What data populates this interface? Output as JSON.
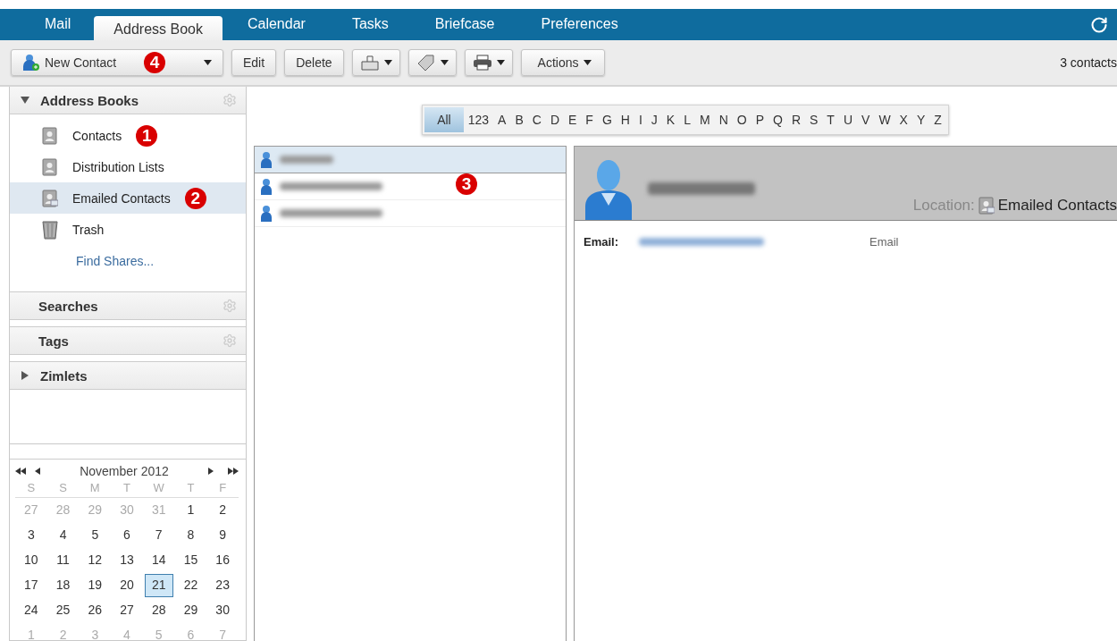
{
  "nav": {
    "tabs": [
      {
        "label": "Mail",
        "selected": false
      },
      {
        "label": "Address Book",
        "selected": true
      },
      {
        "label": "Calendar",
        "selected": false
      },
      {
        "label": "Tasks",
        "selected": false
      },
      {
        "label": "Briefcase",
        "selected": false
      },
      {
        "label": "Preferences",
        "selected": false
      }
    ]
  },
  "toolbar": {
    "new_button": {
      "label": "New Contact",
      "badge": "4"
    },
    "buttons": [
      {
        "kind": "text",
        "label": "Edit"
      },
      {
        "kind": "text",
        "label": "Delete"
      },
      {
        "kind": "move"
      },
      {
        "kind": "tag"
      },
      {
        "kind": "print"
      },
      {
        "kind": "menu",
        "label": "Actions"
      }
    ],
    "count": "3 contacts"
  },
  "sidebar": {
    "sections": [
      {
        "title": "Address Books",
        "expanded": true,
        "items": [
          {
            "kind": "book",
            "label": "Contacts",
            "selected": false,
            "badge": "1"
          },
          {
            "kind": "book",
            "label": "Distribution Lists",
            "selected": false
          },
          {
            "kind": "emailed",
            "label": "Emailed Contacts",
            "selected": true,
            "badge": "2"
          },
          {
            "kind": "trash",
            "label": "Trash",
            "selected": false
          },
          {
            "kind": "link",
            "label": "Find Shares..."
          }
        ]
      },
      {
        "title": "Searches"
      },
      {
        "title": "Tags"
      },
      {
        "title": "Zimlets",
        "expanded": false
      }
    ]
  },
  "calendar": {
    "title": "November 2012",
    "weekdays": [
      "S",
      "S",
      "M",
      "T",
      "W",
      "T",
      "F"
    ],
    "weeks": [
      [
        {
          "d": "27",
          "muted": true,
          "selected": false
        },
        {
          "d": "28",
          "muted": true,
          "selected": false
        },
        {
          "d": "29",
          "muted": true,
          "selected": false
        },
        {
          "d": "30",
          "muted": true,
          "selected": false
        },
        {
          "d": "31",
          "muted": true,
          "selected": false
        },
        {
          "d": "1",
          "muted": false,
          "selected": false
        },
        {
          "d": "2",
          "muted": false,
          "selected": false
        }
      ],
      [
        {
          "d": "3",
          "muted": false,
          "selected": false
        },
        {
          "d": "4",
          "muted": false,
          "selected": false
        },
        {
          "d": "5",
          "muted": false,
          "selected": false
        },
        {
          "d": "6",
          "muted": false,
          "selected": false
        },
        {
          "d": "7",
          "muted": false,
          "selected": false
        },
        {
          "d": "8",
          "muted": false,
          "selected": false
        },
        {
          "d": "9",
          "muted": false,
          "selected": false
        }
      ],
      [
        {
          "d": "10",
          "muted": false,
          "selected": false
        },
        {
          "d": "11",
          "muted": false,
          "selected": false
        },
        {
          "d": "12",
          "muted": false,
          "selected": false
        },
        {
          "d": "13",
          "muted": false,
          "selected": false
        },
        {
          "d": "14",
          "muted": false,
          "selected": false
        },
        {
          "d": "15",
          "muted": false,
          "selected": false
        },
        {
          "d": "16",
          "muted": false,
          "selected": false
        }
      ],
      [
        {
          "d": "17",
          "muted": false,
          "selected": false
        },
        {
          "d": "18",
          "muted": false,
          "selected": false
        },
        {
          "d": "19",
          "muted": false,
          "selected": false
        },
        {
          "d": "20",
          "muted": false,
          "selected": false
        },
        {
          "d": "21",
          "muted": false,
          "selected": true
        },
        {
          "d": "22",
          "muted": false,
          "selected": false
        },
        {
          "d": "23",
          "muted": false,
          "selected": false
        }
      ],
      [
        {
          "d": "24",
          "muted": false,
          "selected": false
        },
        {
          "d": "25",
          "muted": false,
          "selected": false
        },
        {
          "d": "26",
          "muted": false,
          "selected": false
        },
        {
          "d": "27",
          "muted": false,
          "selected": false
        },
        {
          "d": "28",
          "muted": false,
          "selected": false
        },
        {
          "d": "29",
          "muted": false,
          "selected": false
        },
        {
          "d": "30",
          "muted": false,
          "selected": false
        }
      ],
      [
        {
          "d": "1",
          "muted": true,
          "selected": false
        },
        {
          "d": "2",
          "muted": true,
          "selected": false
        },
        {
          "d": "3",
          "muted": true,
          "selected": false
        },
        {
          "d": "4",
          "muted": true,
          "selected": false
        },
        {
          "d": "5",
          "muted": true,
          "selected": false
        },
        {
          "d": "6",
          "muted": true,
          "selected": false
        },
        {
          "d": "7",
          "muted": true,
          "selected": false
        }
      ]
    ]
  },
  "alphabet": [
    {
      "label": "All",
      "selected": true
    },
    {
      "label": "123",
      "selected": false
    },
    {
      "label": "A",
      "selected": false
    },
    {
      "label": "B",
      "selected": false
    },
    {
      "label": "C",
      "selected": false
    },
    {
      "label": "D",
      "selected": false
    },
    {
      "label": "E",
      "selected": false
    },
    {
      "label": "F",
      "selected": false
    },
    {
      "label": "G",
      "selected": false
    },
    {
      "label": "H",
      "selected": false
    },
    {
      "label": "I",
      "selected": false
    },
    {
      "label": "J",
      "selected": false
    },
    {
      "label": "K",
      "selected": false
    },
    {
      "label": "L",
      "selected": false
    },
    {
      "label": "M",
      "selected": false
    },
    {
      "label": "N",
      "selected": false
    },
    {
      "label": "O",
      "selected": false
    },
    {
      "label": "P",
      "selected": false
    },
    {
      "label": "Q",
      "selected": false
    },
    {
      "label": "R",
      "selected": false
    },
    {
      "label": "S",
      "selected": false
    },
    {
      "label": "T",
      "selected": false
    },
    {
      "label": "U",
      "selected": false
    },
    {
      "label": "V",
      "selected": false
    },
    {
      "label": "W",
      "selected": false
    },
    {
      "label": "X",
      "selected": false
    },
    {
      "label": "Y",
      "selected": false
    },
    {
      "label": "Z",
      "selected": false
    }
  ],
  "contact_list": {
    "badge": "3",
    "rows": [
      {
        "selected": true
      },
      {
        "selected": false
      },
      {
        "selected": false
      }
    ]
  },
  "detail": {
    "location_label": "Location:",
    "location": "Emailed Contacts",
    "fields": [
      {
        "label": "Email:",
        "type": "Email"
      }
    ]
  }
}
